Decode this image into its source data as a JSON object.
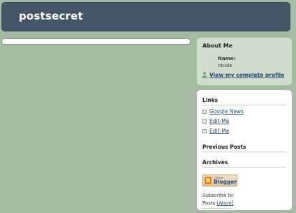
{
  "header": {
    "title": "postsecret"
  },
  "about": {
    "heading": "About Me",
    "name_label": "Name:",
    "name_value": "nicole",
    "profile_link": "View my complete profile"
  },
  "links": {
    "heading": "Links",
    "items": [
      {
        "label": "Google News"
      },
      {
        "label": "Edit-Me"
      },
      {
        "label": "Edit-Me"
      }
    ]
  },
  "previous_posts": {
    "heading": "Previous Posts"
  },
  "archives": {
    "heading": "Archives"
  },
  "badge": {
    "icon_letter": "B",
    "small_text": "I Power",
    "big_text": "Blogger"
  },
  "subscribe": {
    "prefix": "Subscribe to",
    "posts": "Posts",
    "atom": "[Atom]"
  },
  "colors": {
    "page_background": "#a7b9a4",
    "header_background": "#445566",
    "about_background": "#cfdecd",
    "link": "#2a4a6a",
    "blogger_orange": "#f57d00"
  },
  "icons": {
    "profile": "person-icon",
    "bullet": "square-bullet-icon",
    "blogger": "blogger-logo-icon"
  }
}
